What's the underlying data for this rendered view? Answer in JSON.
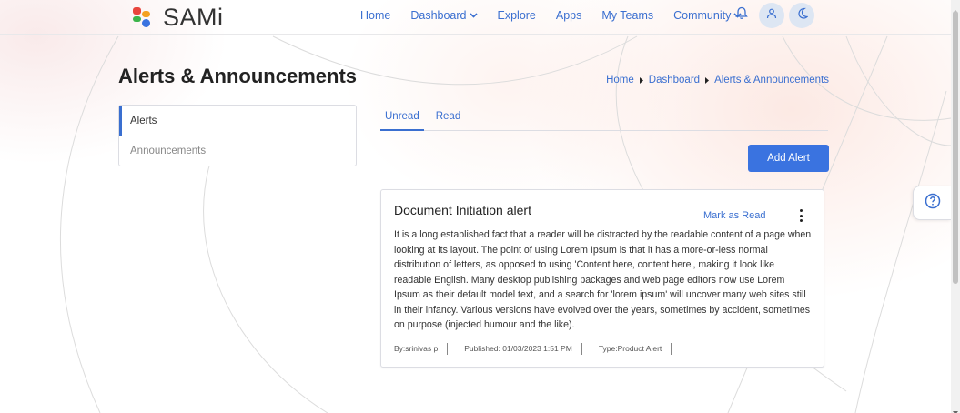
{
  "brand": {
    "name": "SAMi"
  },
  "nav": {
    "items": [
      {
        "label": "Home",
        "has_dropdown": false
      },
      {
        "label": "Dashboard",
        "has_dropdown": true
      },
      {
        "label": "Explore",
        "has_dropdown": false
      },
      {
        "label": "Apps",
        "has_dropdown": false
      },
      {
        "label": "My Teams",
        "has_dropdown": false
      },
      {
        "label": "Community",
        "has_dropdown": true
      }
    ],
    "icons": [
      "bell-icon",
      "user-icon",
      "moon-icon"
    ]
  },
  "page": {
    "title": "Alerts & Announcements"
  },
  "breadcrumb": [
    "Home",
    "Dashboard",
    "Alerts & Announcements"
  ],
  "sidebar": {
    "items": [
      {
        "label": "Alerts",
        "active": true
      },
      {
        "label": "Announcements",
        "active": false
      }
    ]
  },
  "tabs": [
    {
      "label": "Unread",
      "active": true
    },
    {
      "label": "Read",
      "active": false
    }
  ],
  "add_button": {
    "label": "Add Alert"
  },
  "alert": {
    "title": "Document Initiation alert",
    "mark_read_label": "Mark as Read",
    "body": "It is a long established fact that a reader will be distracted by the readable content of a page when looking at its layout. The point of using Lorem Ipsum is that it has a more-or-less normal distribution of letters, as opposed to using 'Content here, content here', making it look like readable English. Many desktop publishing packages and web page editors now use Lorem Ipsum as their default model text, and a search for 'lorem ipsum' will uncover many web sites still in their infancy. Various versions have evolved over the years, sometimes by accident, sometimes on purpose (injected humour and the like).",
    "by": "By:srinivas p",
    "published": "Published: 01/03/2023 1:51 PM",
    "type": "Type:Product Alert"
  },
  "colors": {
    "accent": "#3a6fd0",
    "button": "#3a73e0",
    "logo_red": "#e8453c",
    "logo_orange": "#f4a020",
    "logo_green": "#3bb44a",
    "logo_blue": "#3a73e0"
  }
}
